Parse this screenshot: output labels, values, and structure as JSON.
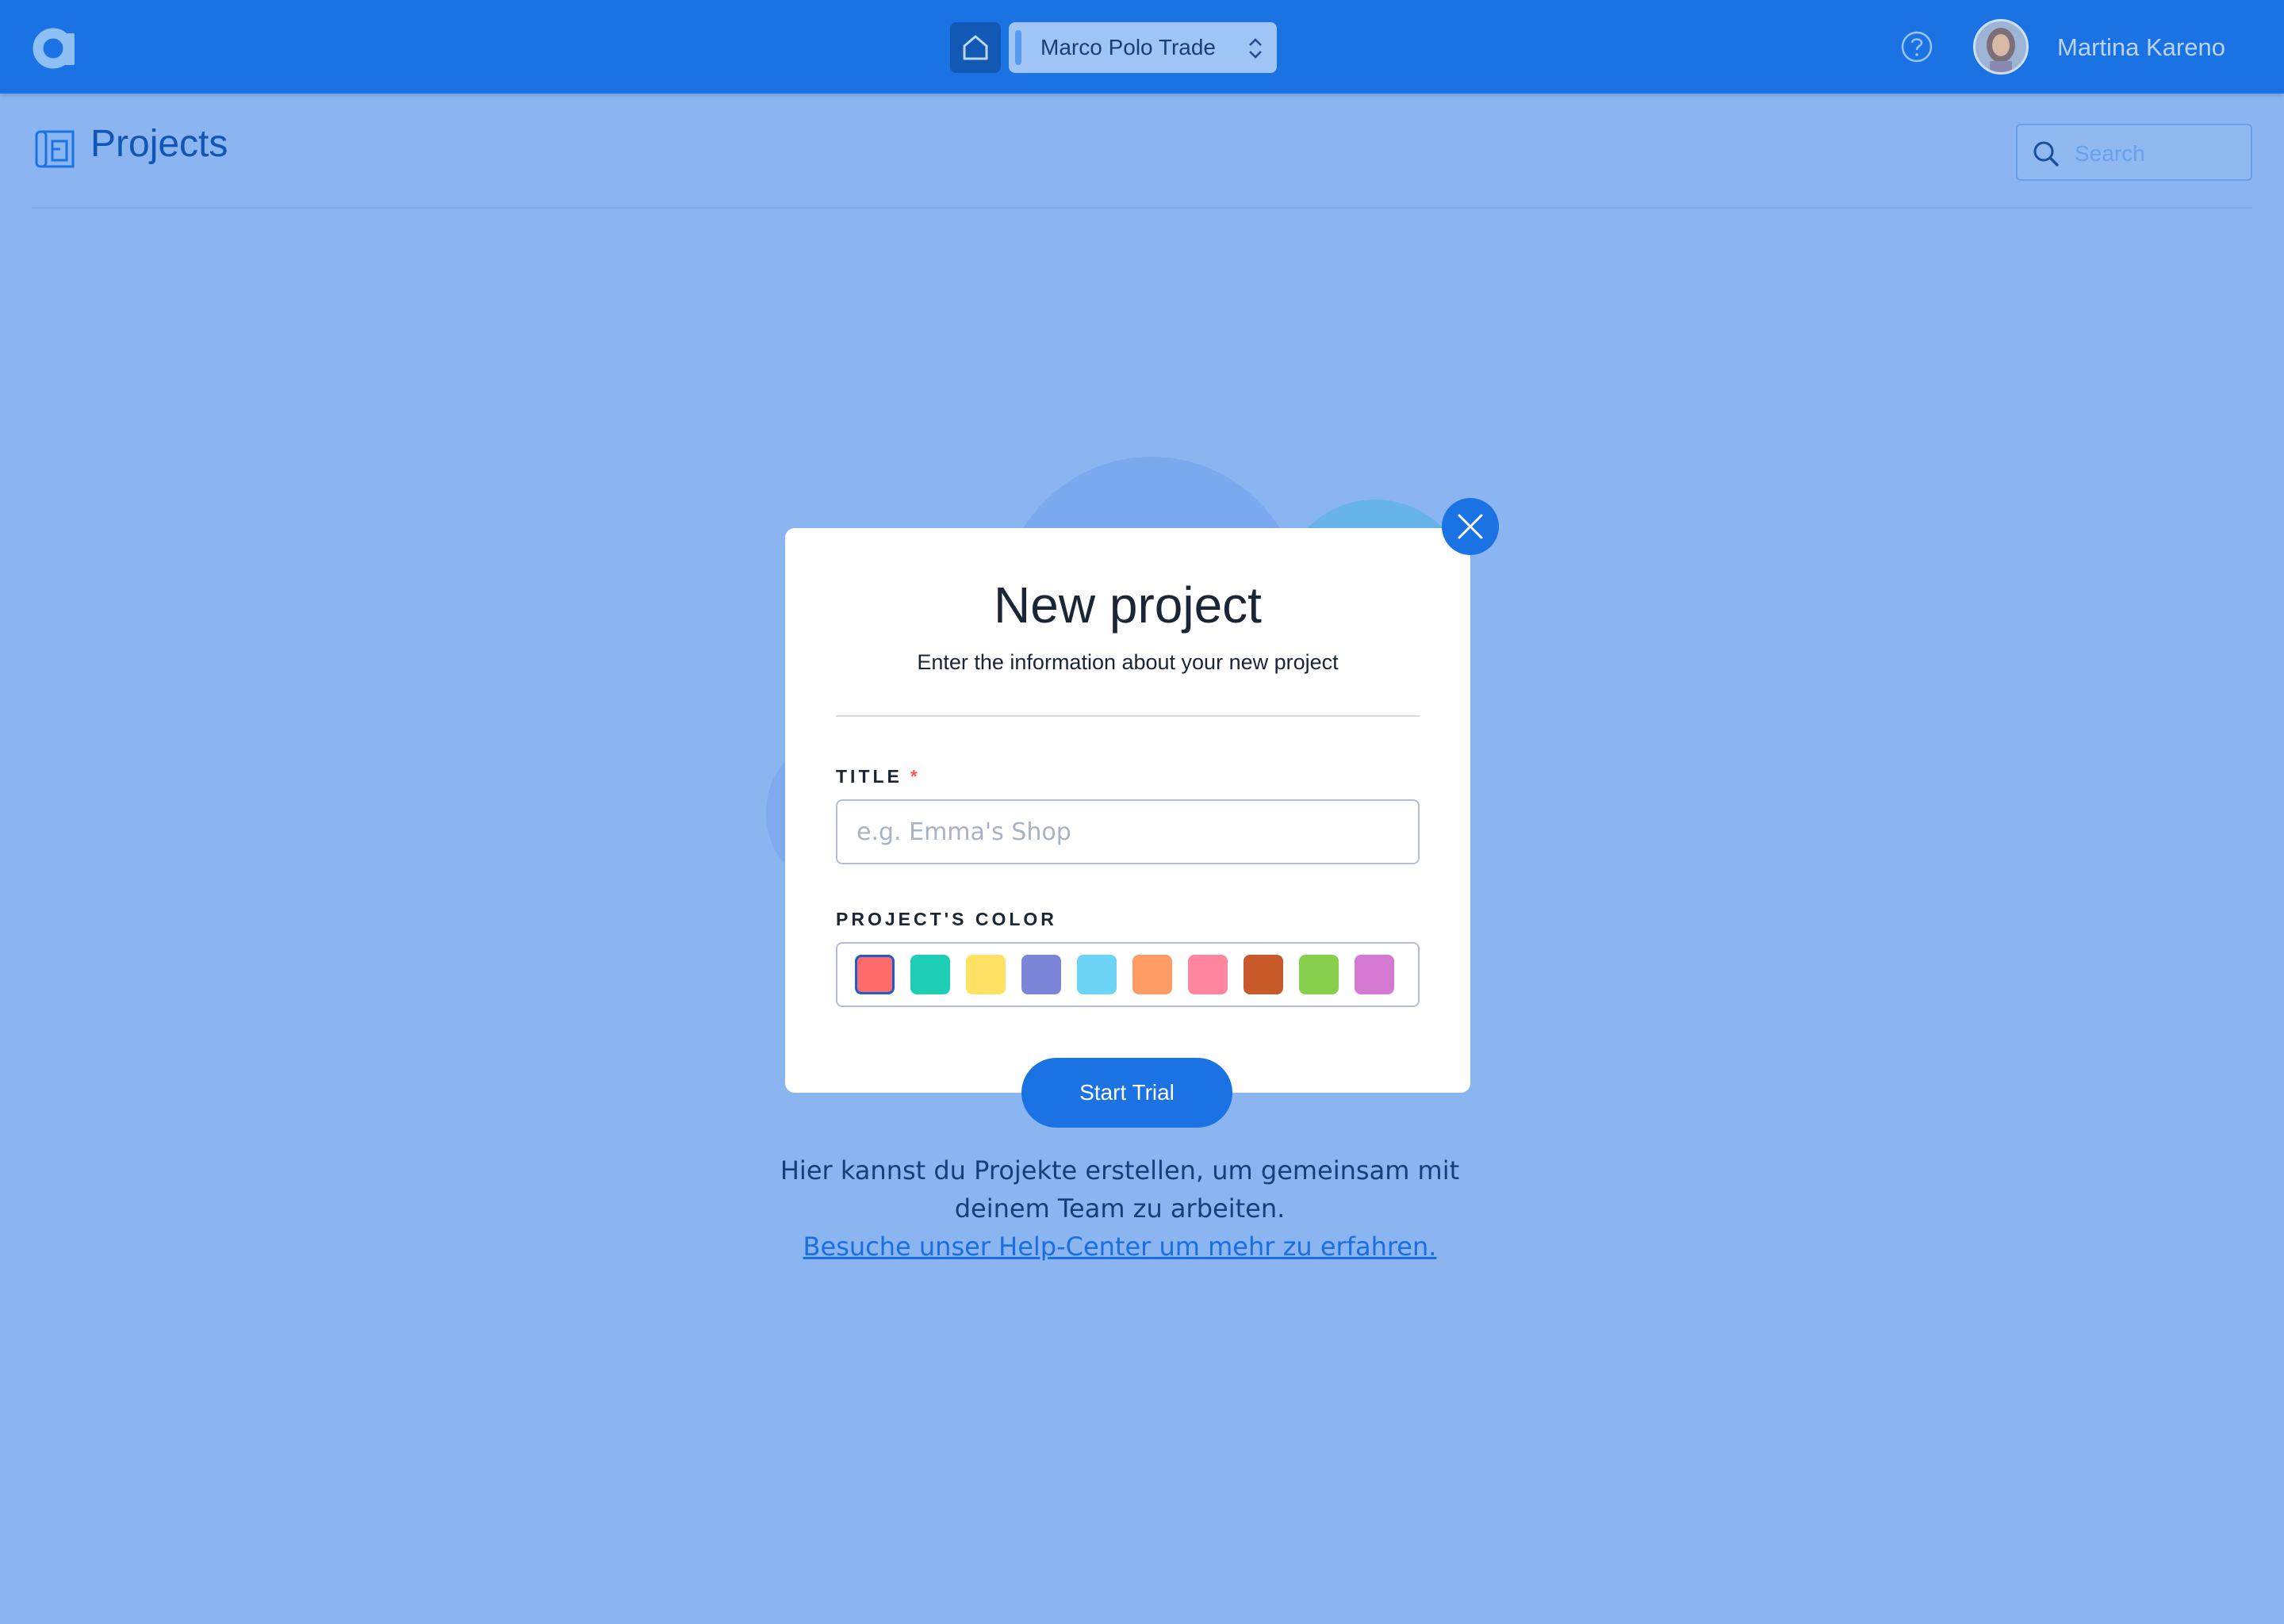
{
  "topbar": {
    "workspace_name": "Marco Polo Trade",
    "user_name": "Martina Kareno",
    "help_icon": "question-circle-icon",
    "home_icon": "home-icon"
  },
  "page": {
    "title": "Projects",
    "search_placeholder": "Search"
  },
  "modal": {
    "title": "New project",
    "subtitle": "Enter the information about your new project",
    "title_label": "TITLE",
    "required_marker": "*",
    "title_placeholder": "e.g. Emma's Shop",
    "color_label": "PROJECT'S COLOR",
    "colors": [
      "#ff6b6b",
      "#1fcfb5",
      "#ffe264",
      "#7b86d6",
      "#6dd3f7",
      "#ff9b64",
      "#ff85a0",
      "#c8592a",
      "#86d04e",
      "#d679d3"
    ],
    "selected_color_index": 0,
    "submit_label": "Start Trial"
  },
  "empty_state": {
    "line1": "Hier kannst du Projekte erstellen, um gemeinsam mit",
    "line2": "deinem Team zu arbeiten.",
    "link": "Besuche unser Help-Center um mehr zu erfahren."
  },
  "colors": {
    "primary": "#1b72e2",
    "overlay_background": "#8ab5f0"
  }
}
